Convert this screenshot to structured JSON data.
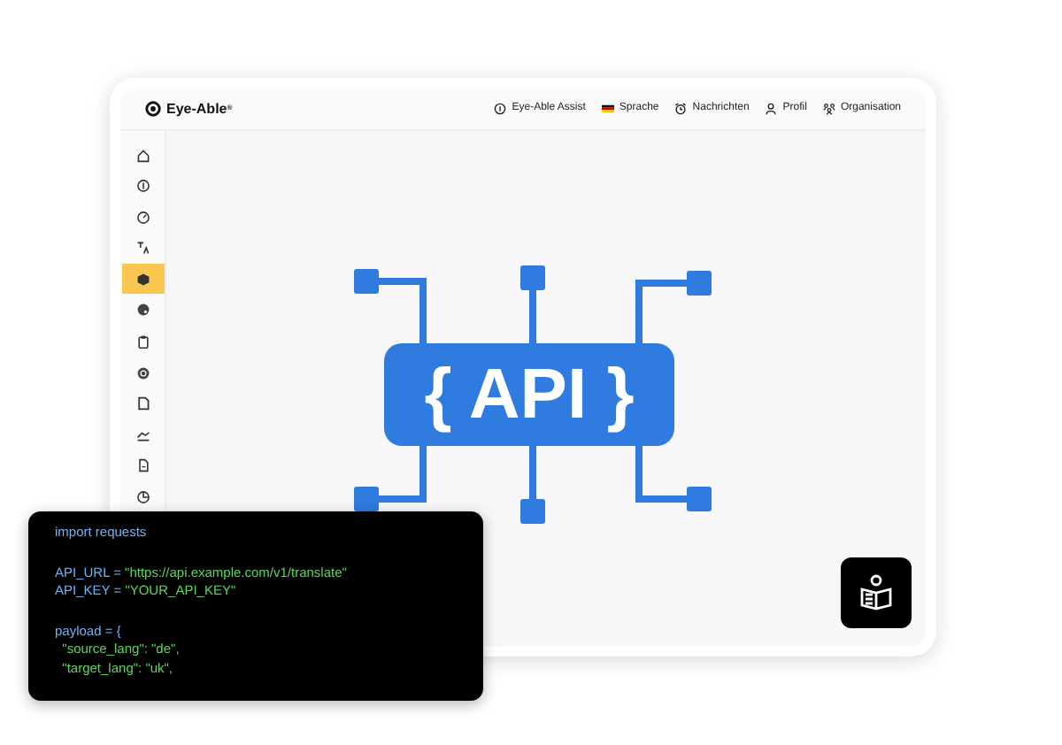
{
  "app": {
    "logo_text": "Eye-Able",
    "logo_mark": "®"
  },
  "nav": [
    {
      "label": "Eye-Able Assist"
    },
    {
      "label": "Sprache"
    },
    {
      "label": "Nachrichten"
    },
    {
      "label": "Profil"
    },
    {
      "label": "Organisation"
    }
  ],
  "sidebar": {
    "items": [
      {
        "selected": false
      },
      {
        "selected": false
      },
      {
        "selected": false
      },
      {
        "selected": false
      },
      {
        "selected": true
      },
      {
        "selected": false
      },
      {
        "selected": false
      },
      {
        "selected": false
      },
      {
        "selected": false
      },
      {
        "selected": false
      },
      {
        "selected": false
      },
      {
        "selected": false
      }
    ]
  },
  "diagram": {
    "label": "{ API }"
  },
  "code": {
    "blocks": [
      {
        "lines": [
          {
            "parts": [
              {
                "text": "import requests",
                "kind": "name"
              }
            ]
          }
        ]
      },
      {
        "lines": [
          {
            "parts": [
              {
                "text": "API_URL = ",
                "kind": "name"
              },
              {
                "text": "\"https://api.example.com/v1/translate\"",
                "kind": "string"
              }
            ]
          },
          {
            "parts": [
              {
                "text": "API_KEY = ",
                "kind": "name"
              },
              {
                "text": "\"YOUR_API_KEY\"",
                "kind": "string"
              }
            ]
          }
        ]
      },
      {
        "lines": [
          {
            "parts": [
              {
                "text": "payload = {",
                "kind": "name"
              }
            ]
          },
          {
            "parts": [
              {
                "text": "  \"source_lang\": \"de\",",
                "kind": "string"
              }
            ]
          },
          {
            "parts": [
              {
                "text": "  \"target_lang\": \"uk\",",
                "kind": "string"
              }
            ]
          }
        ]
      }
    ]
  }
}
